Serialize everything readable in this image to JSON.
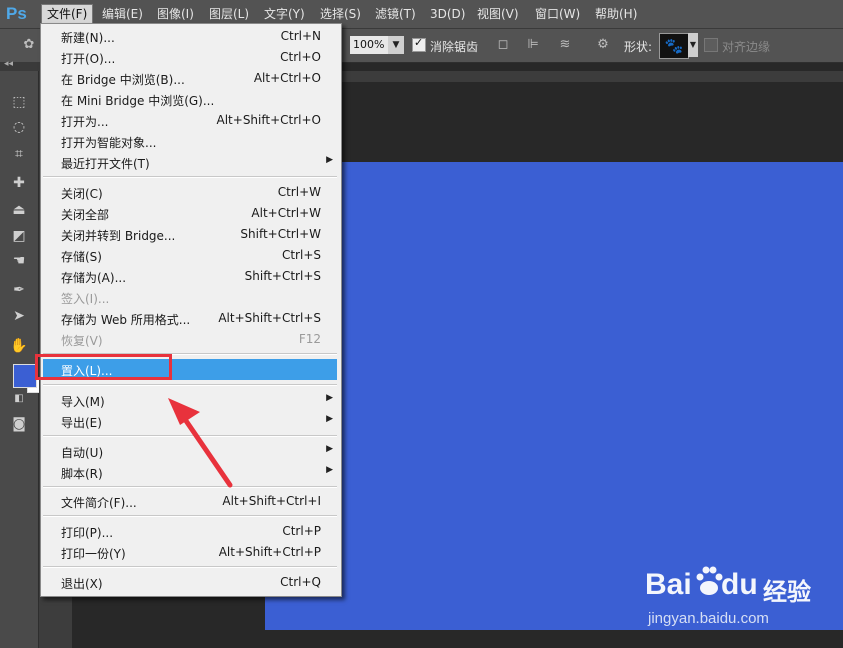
{
  "app": {
    "logo": "Ps"
  },
  "menubar": [
    {
      "label": "文件(F)",
      "active": true
    },
    {
      "label": "编辑(E)"
    },
    {
      "label": "图像(I)"
    },
    {
      "label": "图层(L)"
    },
    {
      "label": "文字(Y)"
    },
    {
      "label": "选择(S)"
    },
    {
      "label": "滤镜(T)"
    },
    {
      "label": "3D(D)"
    },
    {
      "label": "视图(V)"
    },
    {
      "label": "窗口(W)"
    },
    {
      "label": "帮助(H)"
    }
  ],
  "options": {
    "zoom": "100%",
    "anti_alias_label": "消除锯齿",
    "anti_alias_checked": true,
    "shape_label": "形状:",
    "align_edges_label": "对齐边缘",
    "align_edges_checked": false
  },
  "file_menu": [
    {
      "label": "新建(N)...",
      "shortcut": "Ctrl+N"
    },
    {
      "label": "打开(O)...",
      "shortcut": "Ctrl+O"
    },
    {
      "label": "在 Bridge 中浏览(B)...",
      "shortcut": "Alt+Ctrl+O"
    },
    {
      "label": "在 Mini Bridge 中浏览(G)...",
      "shortcut": ""
    },
    {
      "label": "打开为...",
      "shortcut": "Alt+Shift+Ctrl+O"
    },
    {
      "label": "打开为智能对象...",
      "shortcut": ""
    },
    {
      "label": "最近打开文件(T)",
      "shortcut": "",
      "submenu": true
    },
    {
      "label": "关闭(C)",
      "shortcut": "Ctrl+W"
    },
    {
      "label": "关闭全部",
      "shortcut": "Alt+Ctrl+W"
    },
    {
      "label": "关闭并转到 Bridge...",
      "shortcut": "Shift+Ctrl+W"
    },
    {
      "label": "存储(S)",
      "shortcut": "Ctrl+S"
    },
    {
      "label": "存储为(A)...",
      "shortcut": "Shift+Ctrl+S"
    },
    {
      "label": "签入(I)...",
      "shortcut": "",
      "disabled": true
    },
    {
      "label": "存储为 Web 所用格式...",
      "shortcut": "Alt+Shift+Ctrl+S"
    },
    {
      "label": "恢复(V)",
      "shortcut": "F12",
      "disabled": true
    },
    {
      "label": "置入(L)...",
      "shortcut": "",
      "highlighted": true
    },
    {
      "label": "导入(M)",
      "shortcut": "",
      "submenu": true
    },
    {
      "label": "导出(E)",
      "shortcut": "",
      "submenu": true
    },
    {
      "label": "自动(U)",
      "shortcut": "",
      "submenu": true
    },
    {
      "label": "脚本(R)",
      "shortcut": "",
      "submenu": true
    },
    {
      "label": "文件简介(F)...",
      "shortcut": "Alt+Shift+Ctrl+I"
    },
    {
      "label": "打印(P)...",
      "shortcut": "Ctrl+P"
    },
    {
      "label": "打印一份(Y)",
      "shortcut": "Alt+Shift+Ctrl+P"
    },
    {
      "label": "退出(X)",
      "shortcut": "Ctrl+Q"
    }
  ],
  "colors": {
    "foreground": "#3b5fd3",
    "background": "#ffffff",
    "highlight": "#3d9ee8",
    "annotation": "#e8323c"
  },
  "watermark": {
    "brand_latin": "Bai",
    "brand_du": "du",
    "brand_cn": "经验",
    "url": "jingyan.baidu.com"
  }
}
